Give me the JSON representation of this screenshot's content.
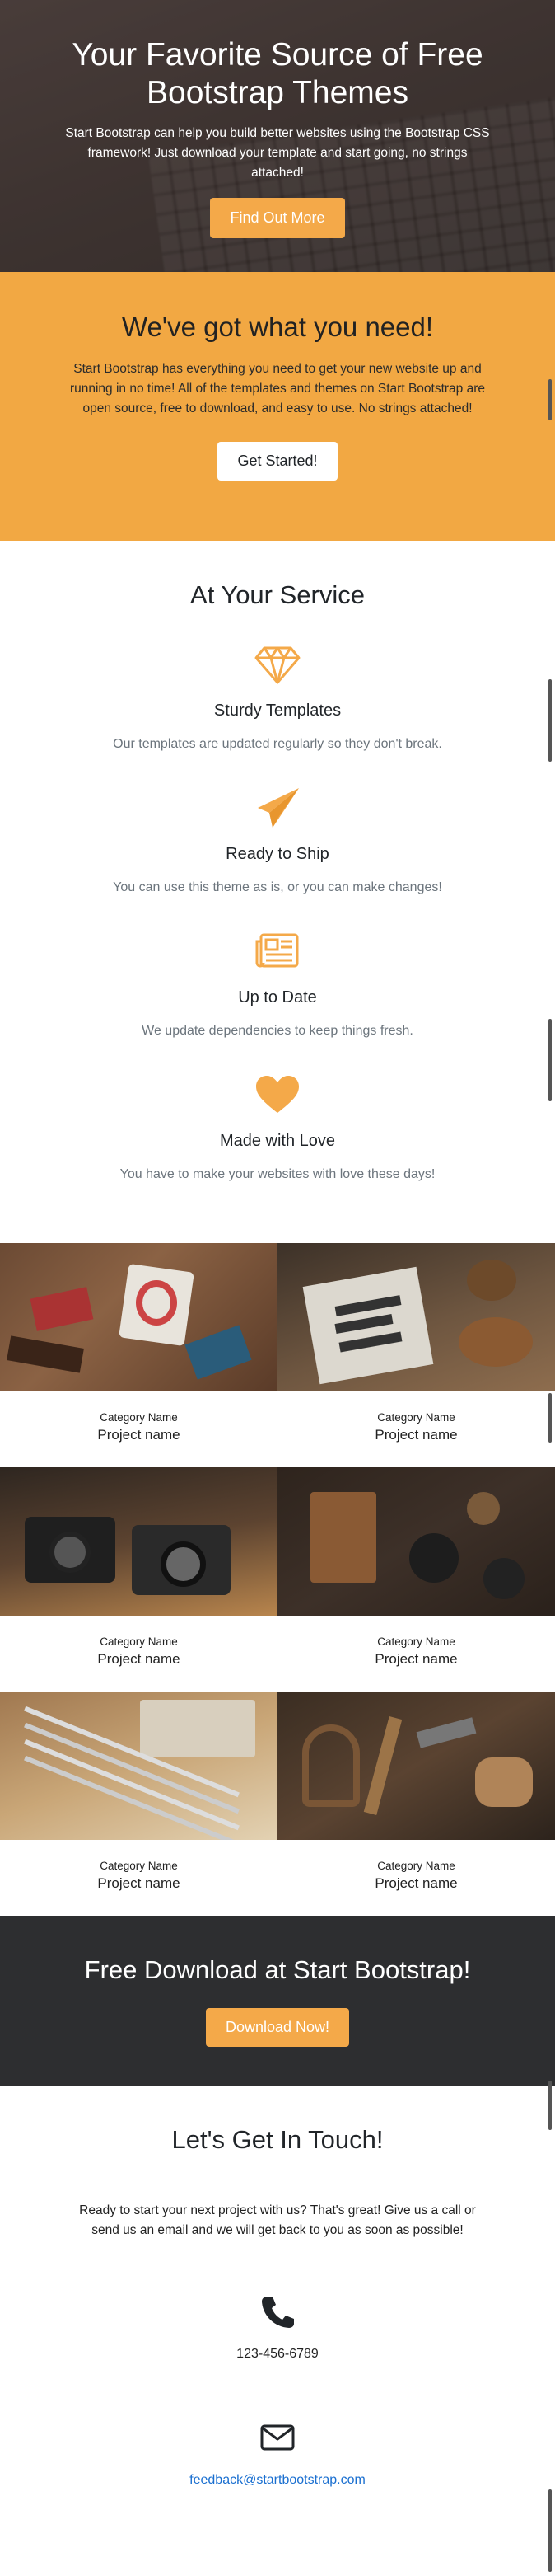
{
  "hero": {
    "title": "Your Favorite Source of Free Bootstrap Themes",
    "text": "Start Bootstrap can help you build better websites using the Bootstrap CSS framework! Just download your template and start going, no strings attached!",
    "button": "Find Out More"
  },
  "about": {
    "title": "We've got what you need!",
    "text": "Start Bootstrap has everything you need to get your new website up and running in no time! All of the templates and themes on Start Bootstrap are open source, free to download, and easy to use. No strings attached!",
    "button": "Get Started!"
  },
  "services": {
    "title": "At Your Service",
    "items": [
      {
        "icon": "gem-icon",
        "title": "Sturdy Templates",
        "text": "Our templates are updated regularly so they don't break."
      },
      {
        "icon": "paper-plane-icon",
        "title": "Ready to Ship",
        "text": "You can use this theme as is, or you can make changes!"
      },
      {
        "icon": "newspaper-icon",
        "title": "Up to Date",
        "text": "We update dependencies to keep things fresh."
      },
      {
        "icon": "heart-icon",
        "title": "Made with Love",
        "text": "You have to make your websites with love these days!"
      }
    ]
  },
  "portfolio": {
    "items": [
      {
        "category": "Category Name",
        "name": "Project name"
      },
      {
        "category": "Category Name",
        "name": "Project name"
      },
      {
        "category": "Category Name",
        "name": "Project name"
      },
      {
        "category": "Category Name",
        "name": "Project name"
      },
      {
        "category": "Category Name",
        "name": "Project name"
      },
      {
        "category": "Category Name",
        "name": "Project name"
      }
    ]
  },
  "cta": {
    "title": "Free Download at Start Bootstrap!",
    "button": "Download Now!"
  },
  "contact": {
    "title": "Let's Get In Touch!",
    "text": "Ready to start your next project with us? That's great! Give us a call or send us an email and we will get back to you as soon as possible!",
    "phone": "123-456-6789",
    "email": "feedback@startbootstrap.com"
  },
  "colors": {
    "primary": "#f4a949",
    "dark": "#2d2e30",
    "link": "#1a6fd0",
    "muted": "#6c757d"
  }
}
